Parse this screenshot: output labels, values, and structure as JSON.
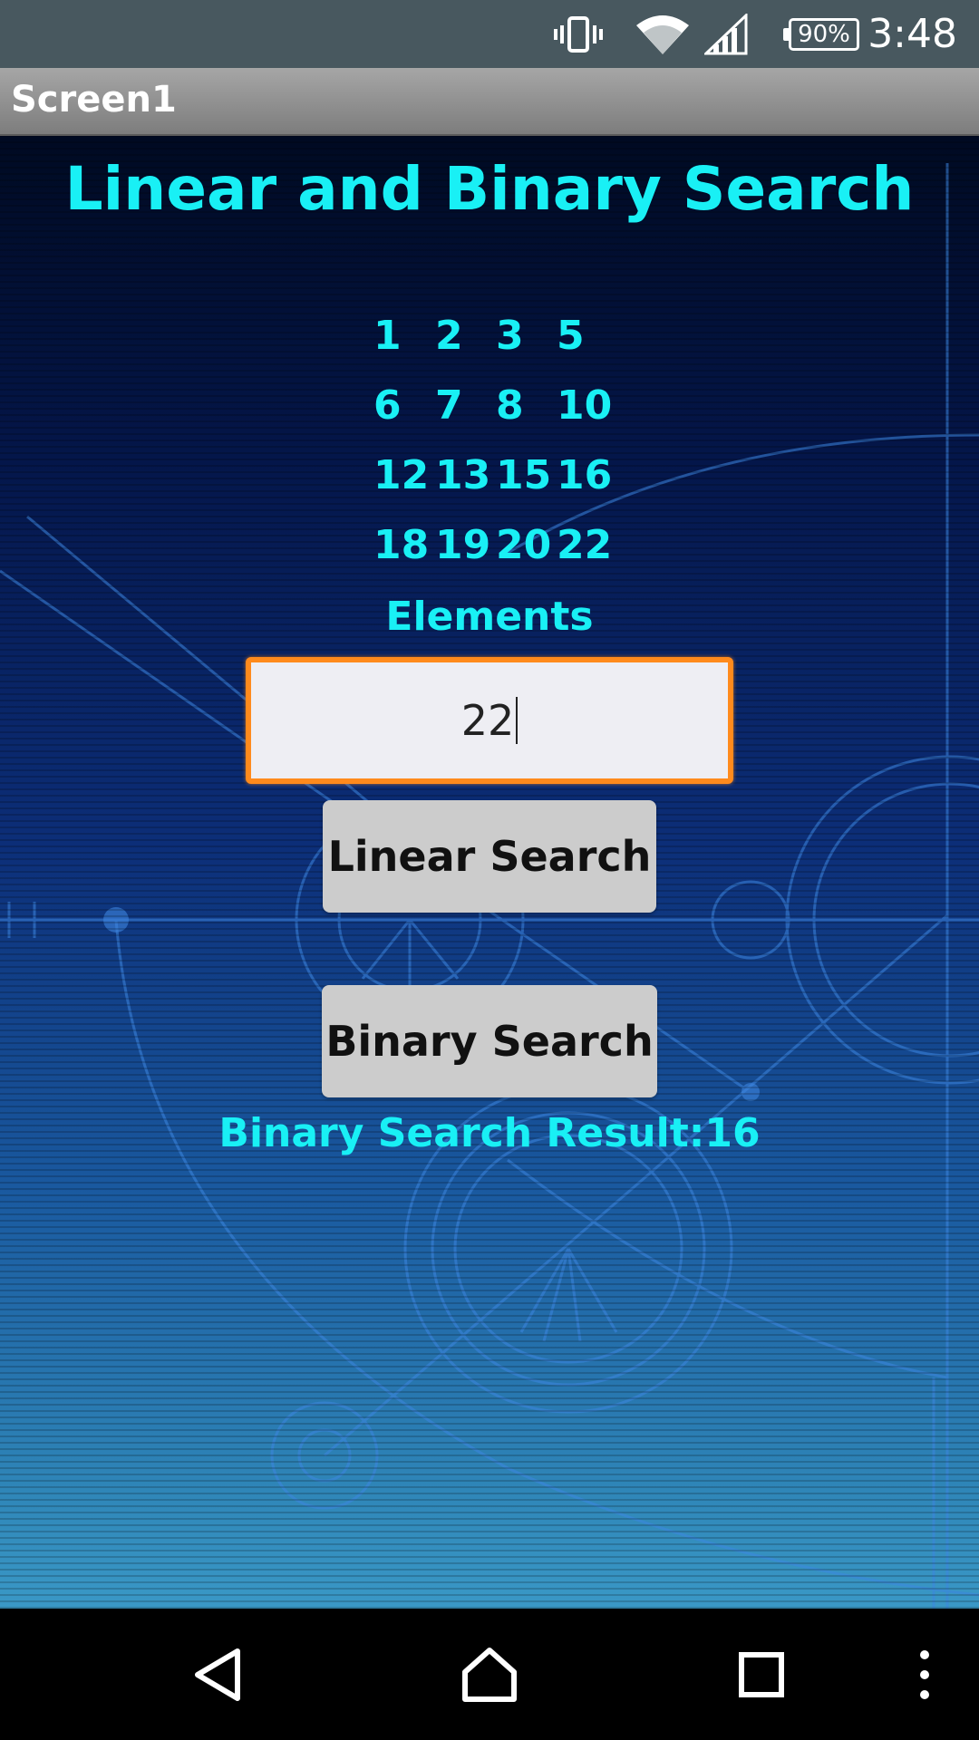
{
  "status_bar": {
    "battery_level": "90%",
    "time": "3:48",
    "icons": [
      "vibrate-icon",
      "wifi-icon",
      "cell-signal-icon",
      "battery-icon"
    ]
  },
  "title_bar": {
    "title": "Screen1"
  },
  "main": {
    "heading": "Linear and Binary Search",
    "number_rows": [
      [
        "1",
        "2",
        "3",
        "5"
      ],
      [
        "6",
        "7",
        "8",
        "10"
      ],
      [
        "12",
        "13",
        "15",
        "16"
      ],
      [
        "18",
        "19",
        "20",
        "22"
      ]
    ],
    "elements_label": "Elements",
    "search_input": {
      "value": "22"
    },
    "linear_button_label": "Linear Search",
    "binary_button_label": "Binary Search",
    "result_text": "Binary Search Result:16"
  },
  "nav_bar": {
    "icons": [
      "back-icon",
      "home-icon",
      "recents-icon",
      "more-icon"
    ]
  },
  "colors": {
    "accent_text": "#19f0f5",
    "input_border": "#ff8a1c",
    "button_bg": "#cccccc",
    "status_bar_bg": "#48585f"
  }
}
